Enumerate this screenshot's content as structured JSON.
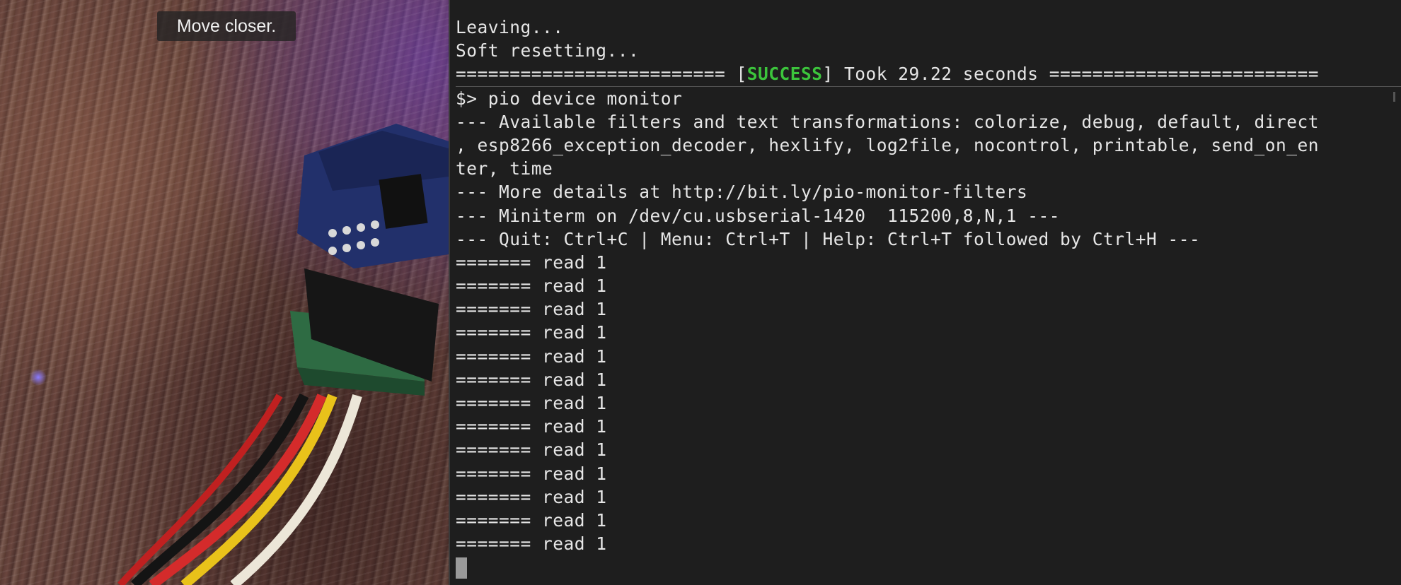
{
  "camera": {
    "tooltip": "Move closer."
  },
  "terminal": {
    "leaving": "Leaving...",
    "soft_reset": "Soft resetting...",
    "success": {
      "left_rule": "========================= [",
      "status": "SUCCESS",
      "right_text": "] Took 29.22 seconds =========================",
      "status_color": "#3cc43c"
    },
    "command": "$> pio device monitor",
    "filters_1": "--- Available filters and text transformations: colorize, debug, default, direct",
    "filters_2": ", esp8266_exception_decoder, hexlify, log2file, nocontrol, printable, send_on_en",
    "filters_3": "ter, time",
    "details": "--- More details at http://bit.ly/pio-monitor-filters",
    "miniterm": "--- Miniterm on /dev/cu.usbserial-1420  115200,8,N,1 ---",
    "quit": "--- Quit: Ctrl+C | Menu: Ctrl+T | Help: Ctrl+T followed by Ctrl+H ---",
    "read_lines": [
      "======= read 1",
      "======= read 1",
      "======= read 1",
      "======= read 1",
      "======= read 1",
      "======= read 1",
      "======= read 1",
      "======= read 1",
      "======= read 1",
      "======= read 1",
      "======= read 1",
      "======= read 1",
      "======= read 1"
    ]
  }
}
